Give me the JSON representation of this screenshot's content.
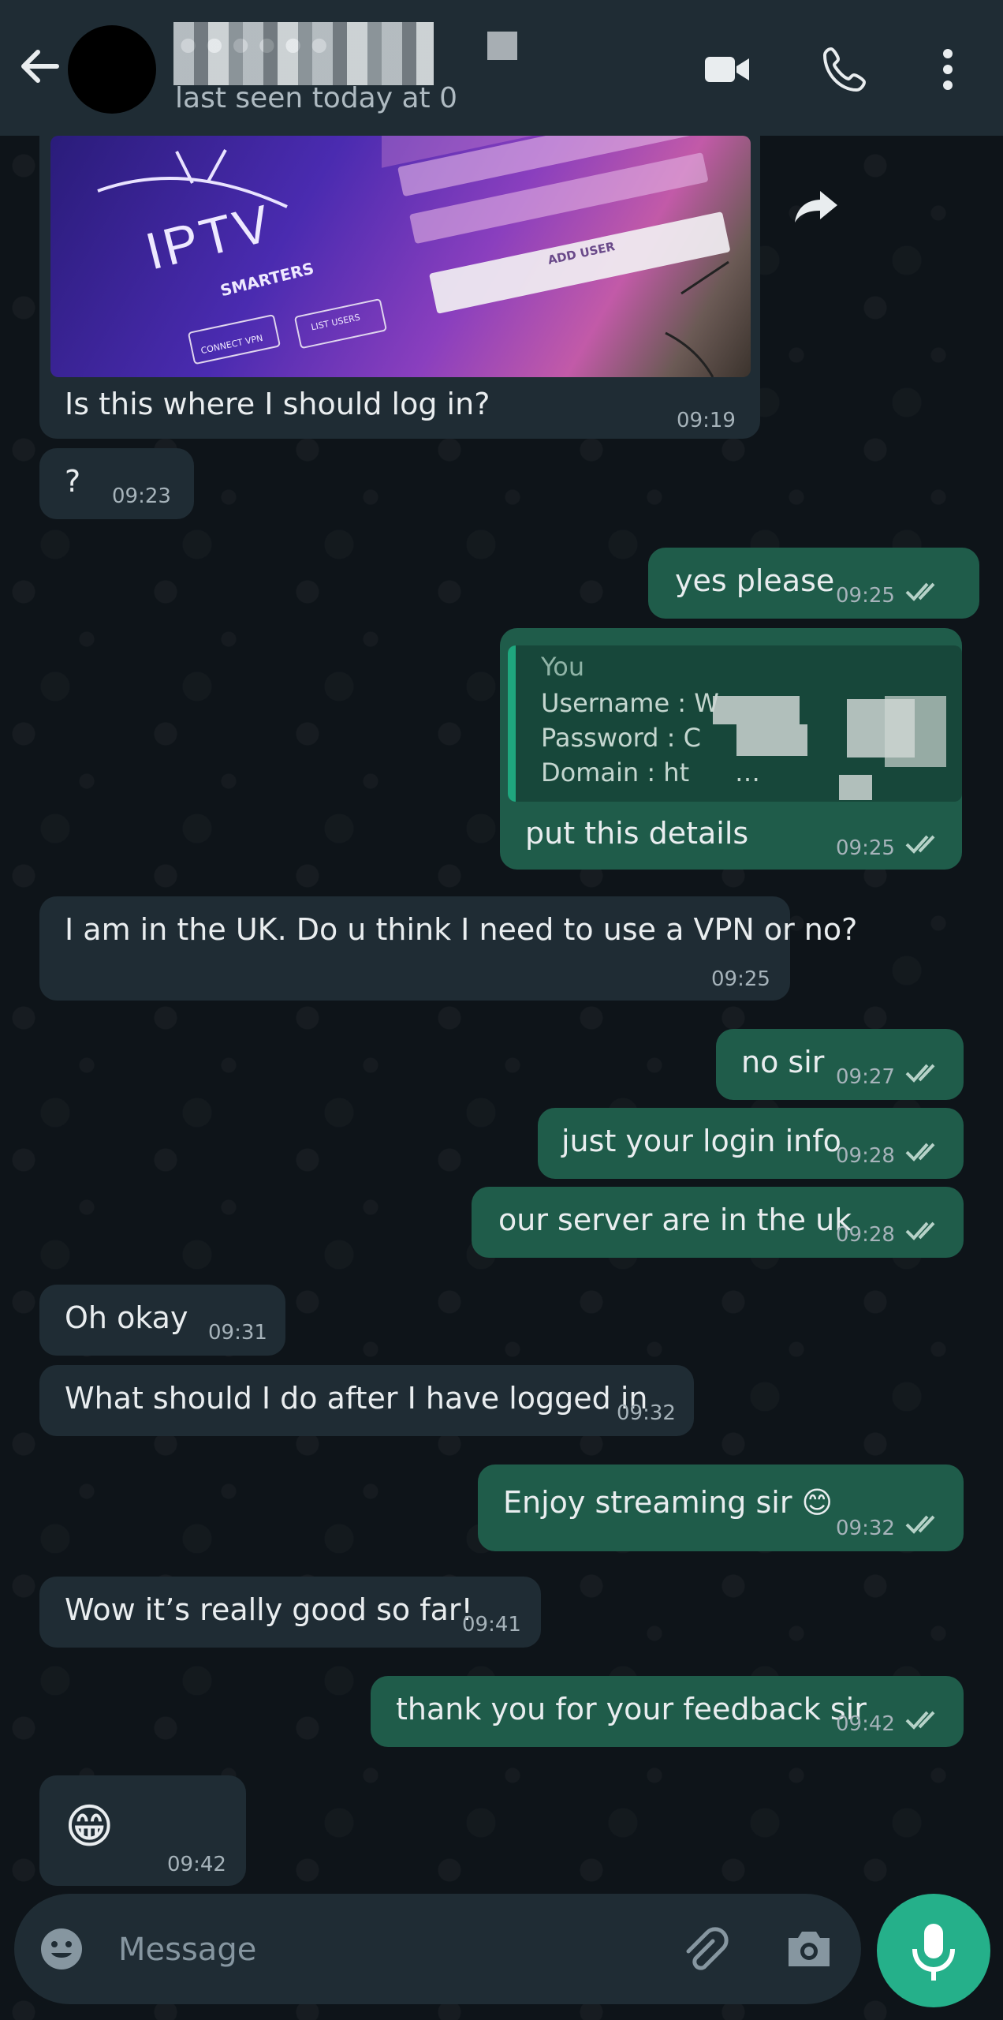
{
  "header": {
    "contact_name": "••••••",
    "last_seen": "last seen today at 0",
    "icons": [
      "back-arrow-icon",
      "video-call-icon",
      "voice-call-icon",
      "more-options-icon"
    ]
  },
  "image_message": {
    "caption": "Is this where I should log in?",
    "time": "09:19",
    "image_texts": {
      "logo": "IPTV",
      "logo_sub": "SMARTERS",
      "add_user": "ADD USER",
      "list_users": "LIST USERS",
      "connect_vpn": "CONNECT VPN"
    }
  },
  "messages": [
    {
      "id": "m1",
      "dir": "in",
      "text": "?",
      "time": "09:23"
    },
    {
      "id": "m2",
      "dir": "out",
      "text": "yes please",
      "time": "09:25"
    },
    {
      "id": "m3",
      "dir": "out",
      "text": "put this details",
      "time": "09:25"
    },
    {
      "id": "m4",
      "dir": "in",
      "text": "I am in the UK. Do u think I need to use a VPN or no?",
      "time": "09:25"
    },
    {
      "id": "m5",
      "dir": "out",
      "text": "no sir",
      "time": "09:27"
    },
    {
      "id": "m6",
      "dir": "out",
      "text": "just your login info",
      "time": "09:28"
    },
    {
      "id": "m7",
      "dir": "out",
      "text": "our server are in the uk",
      "time": "09:28"
    },
    {
      "id": "m8",
      "dir": "in",
      "text": "Oh okay",
      "time": "09:31"
    },
    {
      "id": "m9",
      "dir": "in",
      "text": "What should I do after I have logged in",
      "time": "09:32"
    },
    {
      "id": "m10",
      "dir": "out",
      "text": "Enjoy streaming sir 😊",
      "time": "09:32"
    },
    {
      "id": "m11",
      "dir": "in",
      "text": "Wow it’s really good so far!",
      "time": "09:41"
    },
    {
      "id": "m12",
      "dir": "out",
      "text": "thank you for your feedback sir",
      "time": "09:42"
    },
    {
      "id": "m13",
      "dir": "in",
      "text": "😁",
      "time": "09:42"
    }
  ],
  "quote": {
    "author": "You",
    "username_label": "Username : W",
    "password_label": "Password : C",
    "domain_label": "Domain :  ht",
    "domain_dots": "…"
  },
  "composer": {
    "placeholder": "Message",
    "icons": [
      "emoji-icon",
      "attach-icon",
      "camera-icon",
      "mic-icon"
    ]
  },
  "colors": {
    "background": "#0b141a",
    "header": "#1f2c34",
    "incoming_bubble": "#1f2c34",
    "outgoing_bubble": "#1f5c4a",
    "accent": "#25b08a"
  }
}
